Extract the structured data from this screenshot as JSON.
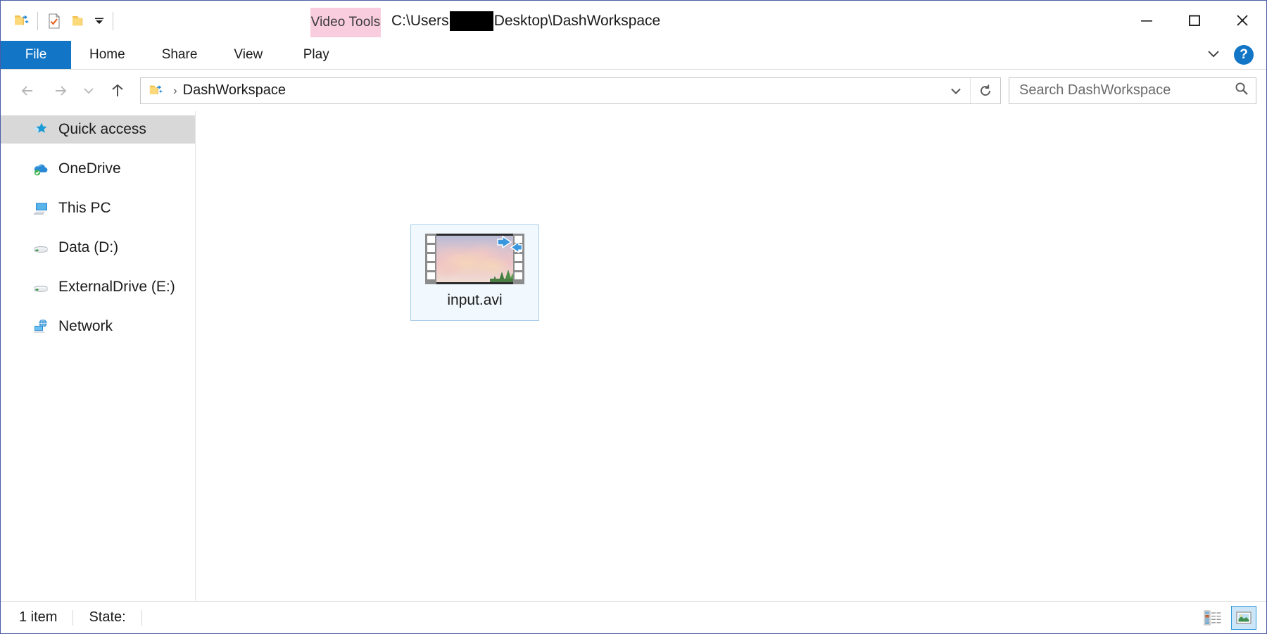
{
  "window": {
    "title_path_prefix": "C:\\Users",
    "title_path_suffix": "Desktop\\DashWorkspace",
    "accent_border": "#4a5ba8"
  },
  "quick_access_toolbar": {
    "system_menu_icon": "folder-arrows-icon",
    "properties_icon": "properties-check-icon",
    "new_folder_icon": "new-folder-icon",
    "customize_icon": "chevron-down-icon"
  },
  "window_controls": {
    "minimize_label": "Minimize",
    "maximize_label": "Maximize",
    "close_label": "Close"
  },
  "contextual_tab": {
    "label": "Video Tools",
    "color": "#f9cddd"
  },
  "ribbon": {
    "tabs": [
      {
        "label": "File",
        "selected": true
      },
      {
        "label": "Home",
        "selected": false
      },
      {
        "label": "Share",
        "selected": false
      },
      {
        "label": "View",
        "selected": false
      },
      {
        "label": "Play",
        "selected": false
      }
    ],
    "expand_icon": "chevron-down-icon",
    "help_label": "?",
    "file_tab_color": "#1275c6"
  },
  "address_bar": {
    "back_icon": "arrow-left-icon",
    "forward_icon": "arrow-right-icon",
    "recent_icon": "chevron-down-icon",
    "up_icon": "arrow-up-icon",
    "breadcrumb_icon": "folder-arrows-icon",
    "breadcrumb_separator": "›",
    "breadcrumb_text": "DashWorkspace",
    "dropdown_icon": "chevron-down-icon",
    "refresh_icon": "refresh-icon"
  },
  "search": {
    "placeholder": "Search DashWorkspace",
    "icon": "search-icon"
  },
  "sidebar": {
    "items": [
      {
        "label": "Quick access",
        "icon": "star-pin-icon",
        "selected": true
      },
      {
        "label": "OneDrive",
        "icon": "onedrive-cloud-icon",
        "selected": false
      },
      {
        "label": "This PC",
        "icon": "this-pc-monitor-icon",
        "selected": false
      },
      {
        "label": "Data (D:)",
        "icon": "hard-drive-icon",
        "selected": false
      },
      {
        "label": "ExternalDrive (E:)",
        "icon": "hard-drive-icon",
        "selected": false
      },
      {
        "label": "Network",
        "icon": "network-globe-icon",
        "selected": false
      }
    ]
  },
  "files": [
    {
      "name": "input.avi",
      "icon": "video-filmstrip-thumbnail",
      "selected": true,
      "thumbnail_description": "pink clouds sky with green trees",
      "shortcut_badge": true
    }
  ],
  "status_bar": {
    "item_count": "1 item",
    "state_label": "State:",
    "view_buttons": [
      {
        "name": "details-view",
        "active": false
      },
      {
        "name": "large-icons-view",
        "active": true
      }
    ]
  }
}
